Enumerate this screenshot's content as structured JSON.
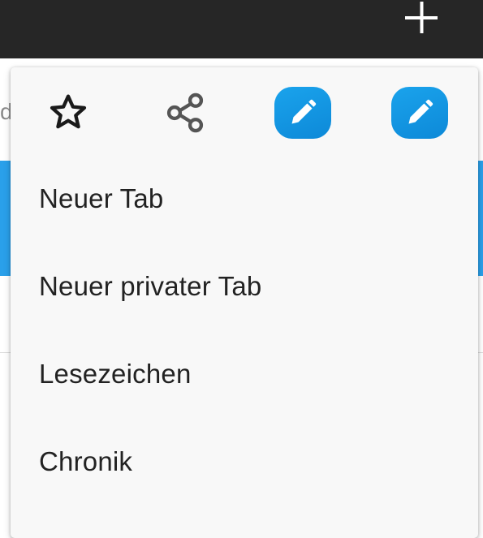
{
  "toolbar": {
    "new_tab_icon": "plus-icon",
    "background_color": "#262626"
  },
  "background": {
    "partial_text": "d",
    "accent_color": "#2aa0ea"
  },
  "menu": {
    "icons": [
      {
        "name": "star-icon",
        "action": "bookmark"
      },
      {
        "name": "share-icon",
        "action": "share"
      },
      {
        "name": "pencil-app-icon",
        "action": "edit"
      },
      {
        "name": "pencil-app-icon",
        "action": "edit"
      }
    ],
    "items": [
      {
        "label": "Neuer Tab"
      },
      {
        "label": "Neuer privater Tab"
      },
      {
        "label": "Lesezeichen"
      },
      {
        "label": "Chronik"
      }
    ]
  }
}
